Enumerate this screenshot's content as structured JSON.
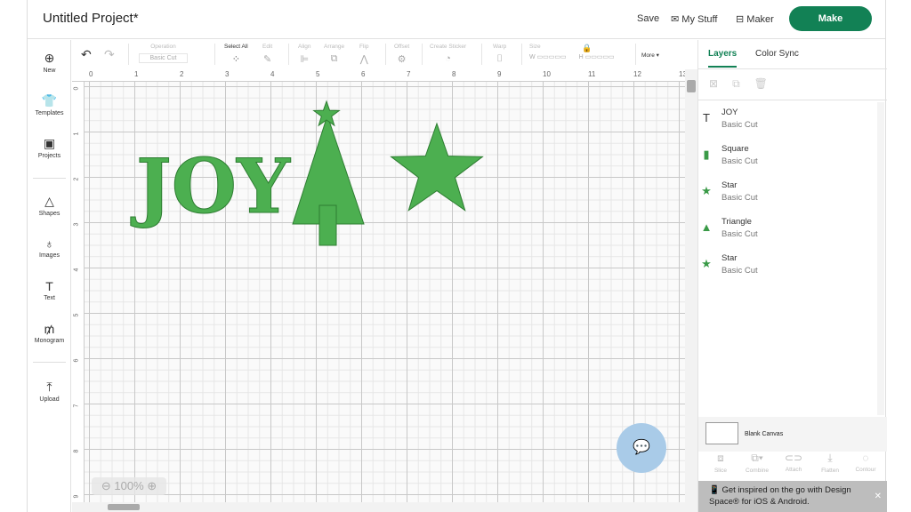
{
  "header": {
    "title": "Untitled Project*",
    "save": "Save",
    "my_stuff": "My Stuff",
    "maker": "Maker",
    "make": "Make"
  },
  "sidebar": {
    "items": [
      {
        "label": "New",
        "icon": "plus-circle-icon"
      },
      {
        "label": "Templates",
        "icon": "shirt-icon"
      },
      {
        "label": "Projects",
        "icon": "projects-icon"
      },
      {
        "label": "Shapes",
        "icon": "shapes-icon"
      },
      {
        "label": "Images",
        "icon": "lightbulb-icon"
      },
      {
        "label": "Text",
        "icon": "text-icon"
      },
      {
        "label": "Monogram",
        "icon": "monogram-icon"
      },
      {
        "label": "Upload",
        "icon": "upload-icon"
      }
    ]
  },
  "toolbar": {
    "operation": "Operation",
    "operation_value": "Basic Cut",
    "select_all": "Select All",
    "edit": "Edit",
    "align": "Align",
    "arrange": "Arrange",
    "flip": "Flip",
    "offset": "Offset",
    "create_sticker": "Create Sticker",
    "warp": "Warp",
    "size": "Size",
    "w": "W",
    "h": "H",
    "more": "More"
  },
  "ruler": {
    "x": [
      "0",
      "1",
      "2",
      "3",
      "4",
      "5",
      "6",
      "7",
      "8",
      "9",
      "10",
      "11",
      "12",
      "13"
    ],
    "y": [
      "0",
      "1",
      "2",
      "3",
      "4",
      "5",
      "6",
      "7",
      "8",
      "9"
    ]
  },
  "canvas": {
    "text": "JOY",
    "fill": "#4caf50",
    "zoom": "100%"
  },
  "panel": {
    "tabs": [
      "Layers",
      "Color Sync"
    ],
    "layers": [
      {
        "name": "JOY",
        "type": "Basic Cut",
        "icon": "text-icon"
      },
      {
        "name": "Square",
        "type": "Basic Cut",
        "icon": "square-icon"
      },
      {
        "name": "Star",
        "type": "Basic Cut",
        "icon": "star-icon"
      },
      {
        "name": "Triangle",
        "type": "Basic Cut",
        "icon": "triangle-icon"
      },
      {
        "name": "Star",
        "type": "Basic Cut",
        "icon": "star-icon"
      }
    ],
    "blank_canvas": "Blank Canvas",
    "actions": [
      "Slice",
      "Combine",
      "Attach",
      "Flatten",
      "Contour"
    ],
    "banner": "Get inspired on the go with Design Space® for iOS & Android."
  },
  "colors": {
    "accent": "#128155",
    "shape": "#4caf50"
  }
}
